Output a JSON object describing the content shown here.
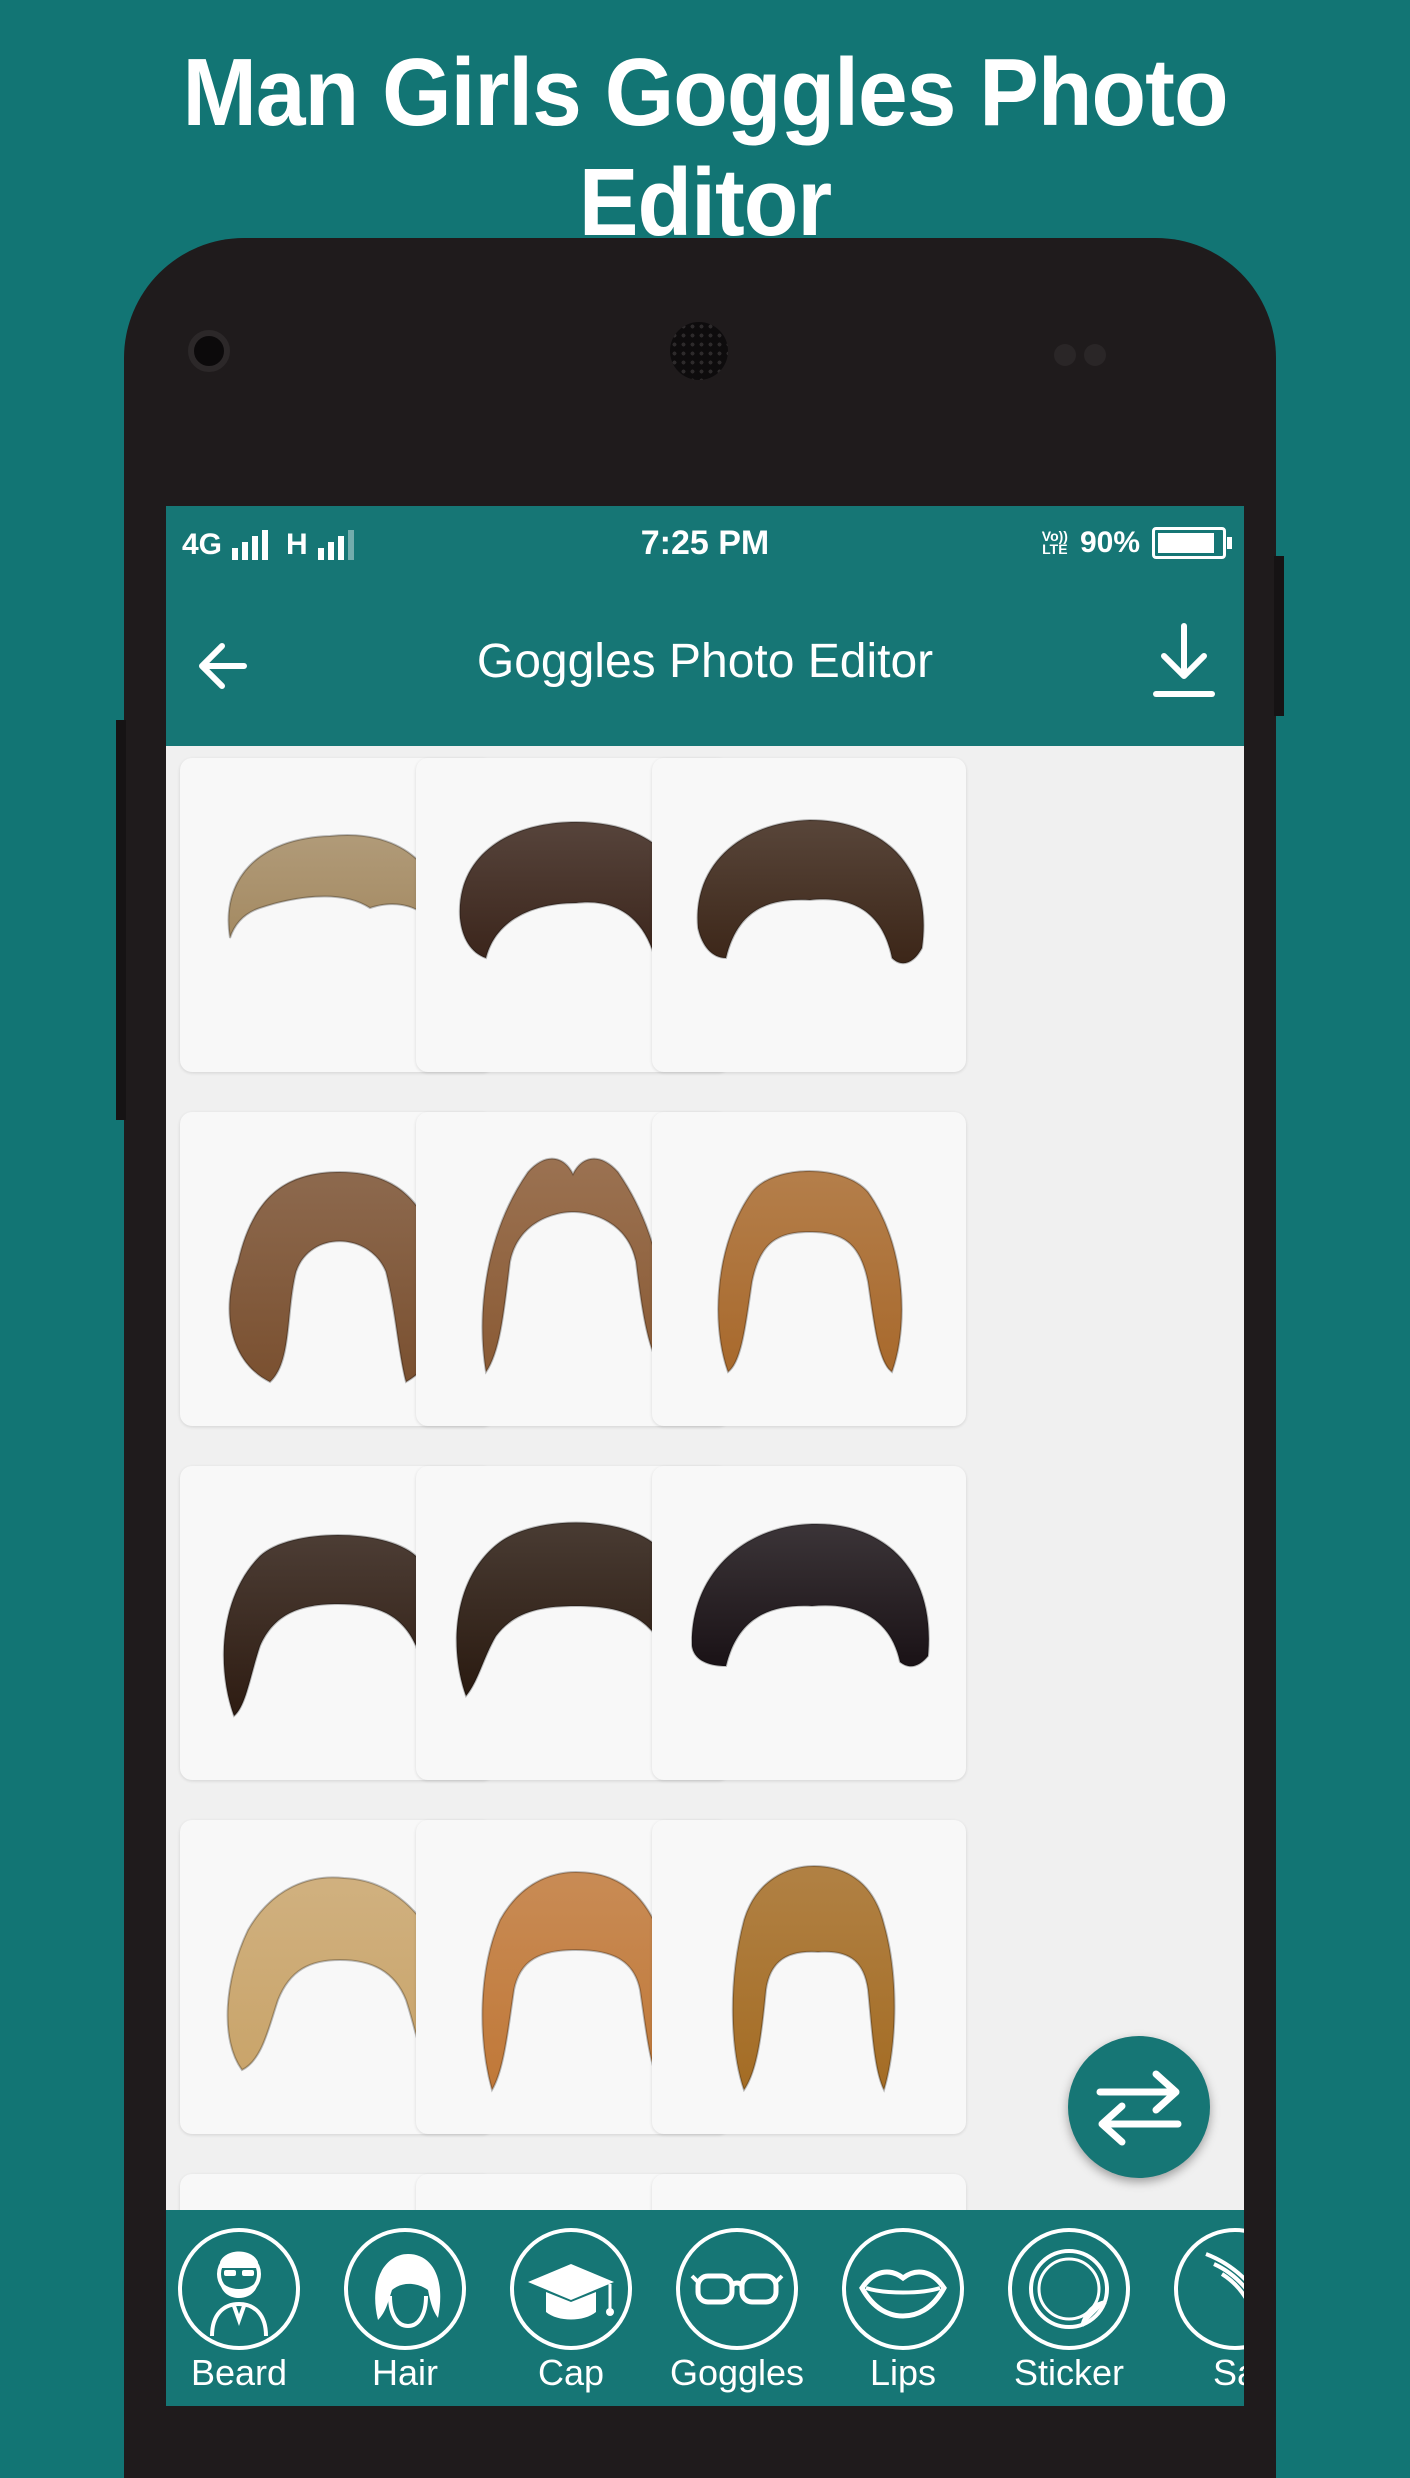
{
  "promo": {
    "title": "Man Girls Goggles Photo Editor"
  },
  "status_bar": {
    "network_left": "4G",
    "network_right": "H",
    "time": "7:25 PM",
    "volte_top": "Vo))",
    "volte_bottom": "LTE",
    "battery": "90%",
    "battery_level": 0.9
  },
  "toolbar": {
    "title": "Goggles Photo Editor",
    "back_icon": "arrow-left-icon",
    "download_icon": "download-icon"
  },
  "hair_grid": {
    "items": [
      {
        "name": "short-ash-blonde-men",
        "color": "#a48a62"
      },
      {
        "name": "dark-brown-quiff",
        "color": "#3a241a"
      },
      {
        "name": "spiky-brown",
        "color": "#3c2618"
      },
      {
        "name": "wavy-bob-brown",
        "color": "#7a5030"
      },
      {
        "name": "long-straight-brown",
        "color": "#8a5a34"
      },
      {
        "name": "long-curly-auburn",
        "color": "#a8692c"
      },
      {
        "name": "short-curly-dark",
        "color": "#2e1c12"
      },
      {
        "name": "curly-shag-dark",
        "color": "#2a1a10"
      },
      {
        "name": "messy-black",
        "color": "#1a1216"
      },
      {
        "name": "blonde-curled-bob",
        "color": "#c9a46a"
      },
      {
        "name": "ginger-updo",
        "color": "#c07838"
      },
      {
        "name": "long-golden-brown",
        "color": "#a46c24"
      }
    ]
  },
  "fab": {
    "icon": "swap-arrows-icon"
  },
  "bottom_bar": {
    "items": [
      {
        "label": "Beard",
        "icon": "beard-man-icon"
      },
      {
        "label": "Hair",
        "icon": "hair-icon"
      },
      {
        "label": "Cap",
        "icon": "graduation-cap-icon"
      },
      {
        "label": "Goggles",
        "icon": "goggles-icon"
      },
      {
        "label": "Lips",
        "icon": "lips-icon"
      },
      {
        "label": "Sticker",
        "icon": "sticker-icon"
      },
      {
        "label": "Sa",
        "icon": "saree-icon"
      }
    ]
  }
}
